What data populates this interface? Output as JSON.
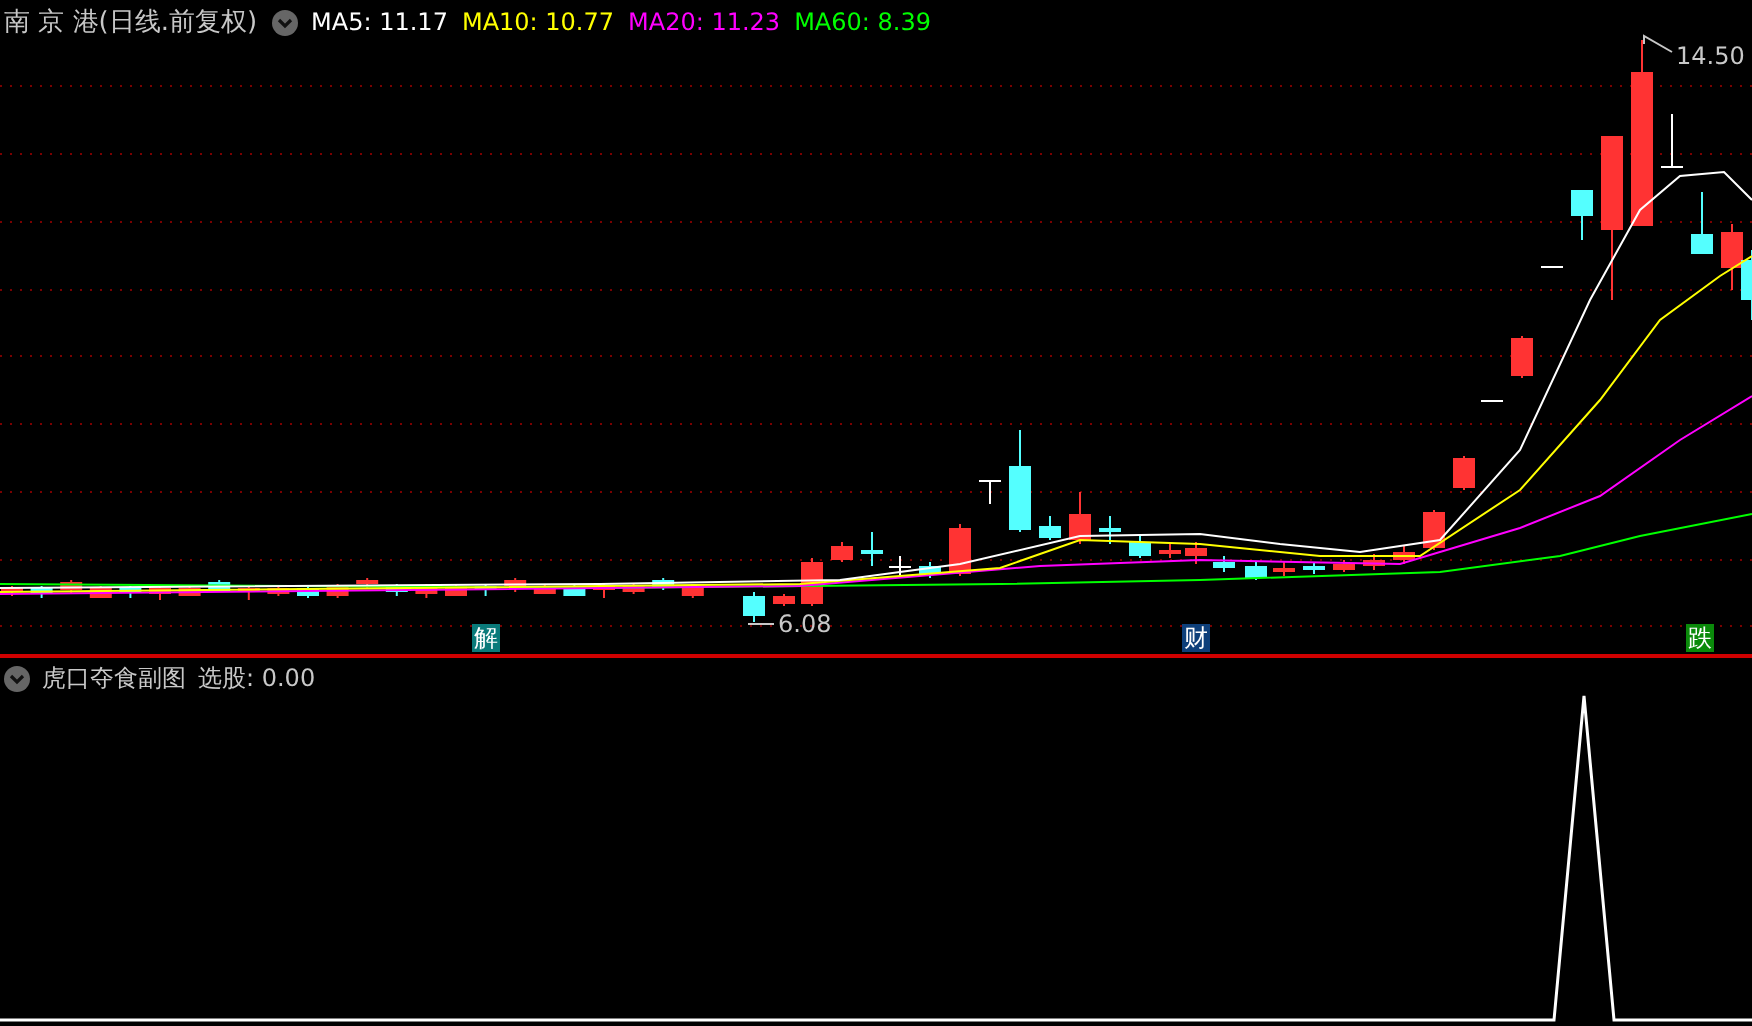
{
  "main_chart": {
    "title": "南 京 港(日线.前复权)",
    "indicators": [
      {
        "label": "MA5: 11.17",
        "color": "#ffffff"
      },
      {
        "label": "MA10: 10.77",
        "color": "#ffff00"
      },
      {
        "label": "MA20: 11.23",
        "color": "#ff00ff"
      },
      {
        "label": "MA60: 8.39",
        "color": "#00ff00"
      }
    ],
    "high_label": "14.50",
    "low_label": "6.08",
    "markers": [
      {
        "text": "解",
        "color": "#0a7a7a"
      },
      {
        "text": "财",
        "color": "#0d3f7a"
      },
      {
        "text": "跌",
        "color": "#0a8a0a"
      }
    ]
  },
  "sub_chart": {
    "title": "虎口夺食副图",
    "reading": "选股: 0.00"
  }
}
